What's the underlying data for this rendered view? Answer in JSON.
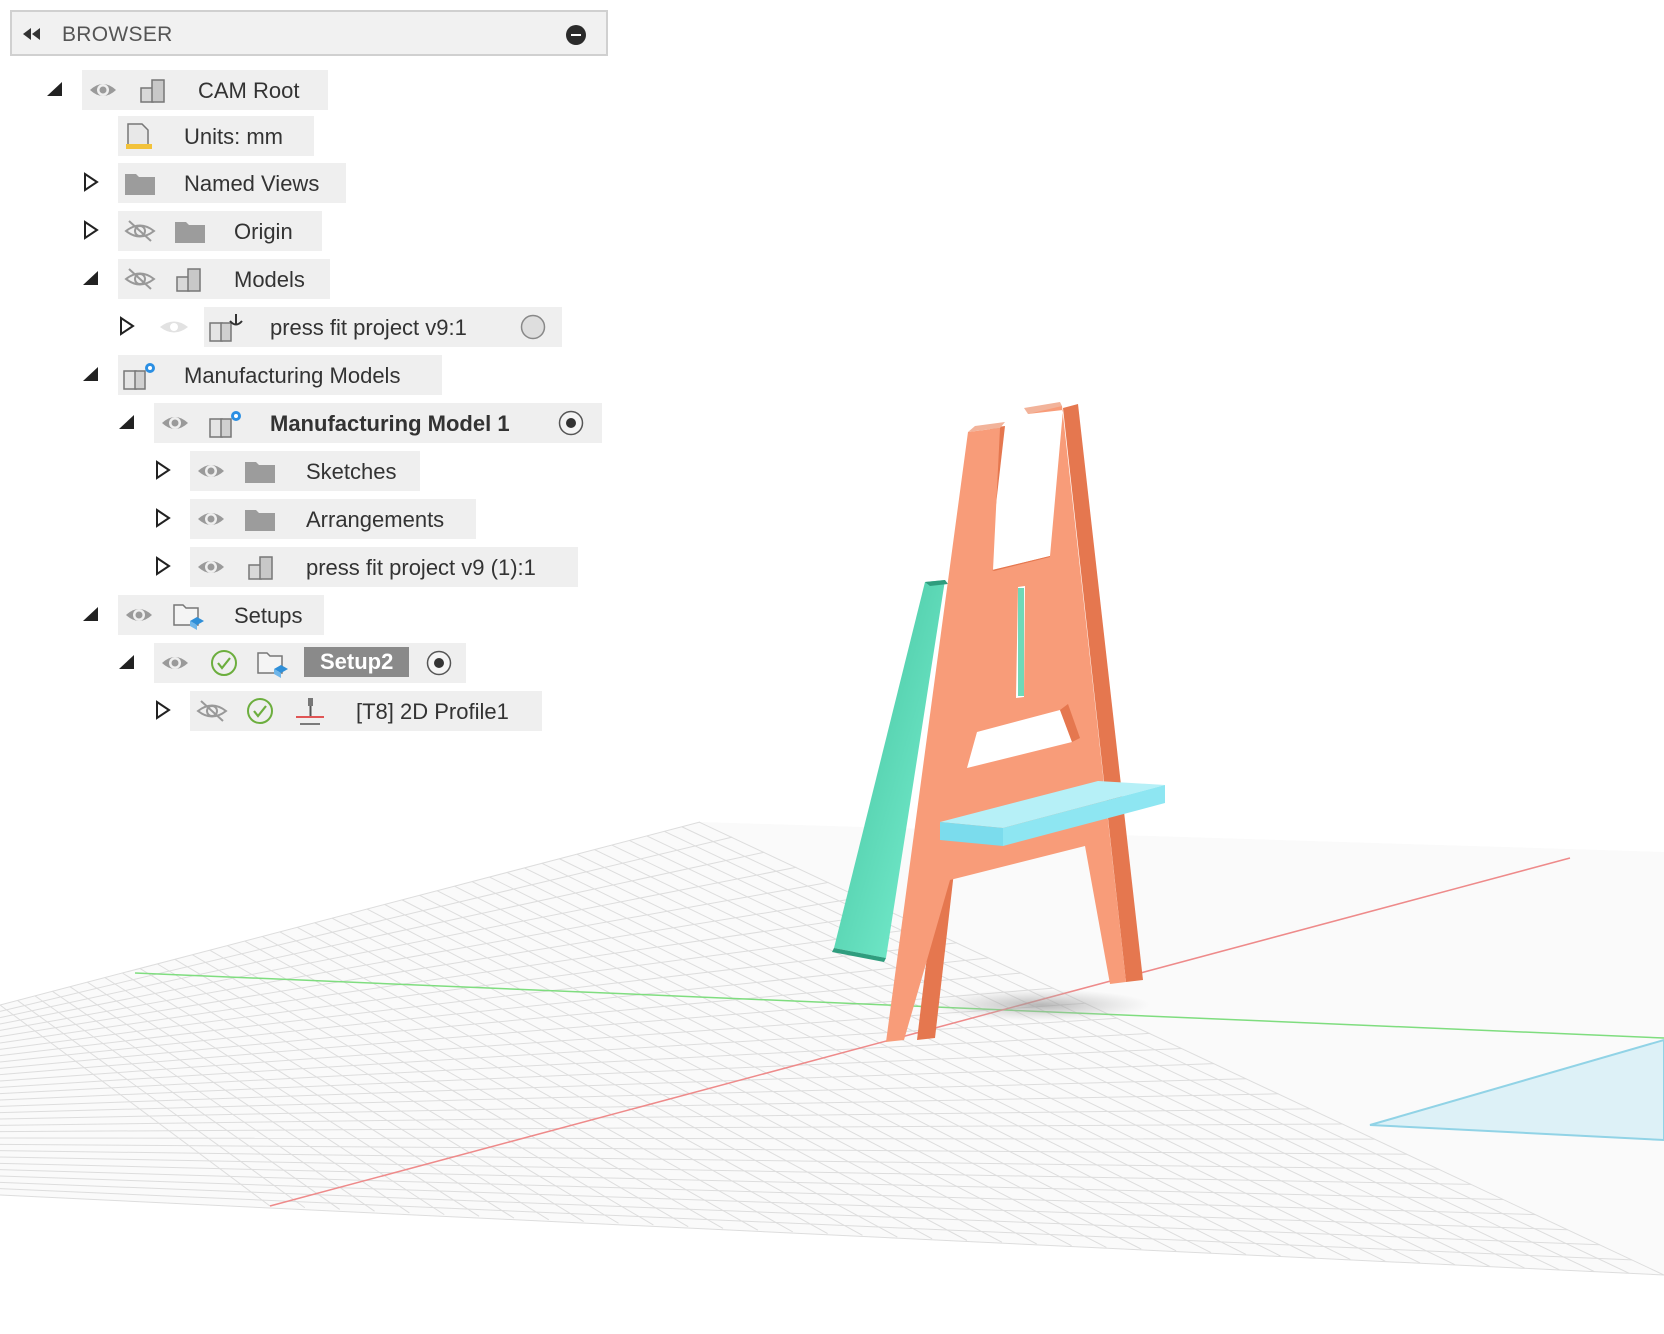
{
  "browser": {
    "title": "BROWSER",
    "icons": {
      "collapse": "double-left-arrow-icon",
      "close": "minus-circle-icon"
    }
  },
  "tree": {
    "cam_root": "CAM Root",
    "units": "Units: mm",
    "named_views": "Named Views",
    "origin": "Origin",
    "models": "Models",
    "press_fit": "press fit project v9:1",
    "manufacturing_models": "Manufacturing Models",
    "manufacturing_model_1": "Manufacturing Model 1",
    "sketches": "Sketches",
    "arrangements": "Arrangements",
    "press_fit_copy": "press fit project v9 (1):1",
    "setups": "Setups",
    "setup2": "Setup2",
    "profile": "[T8] 2D Profile1"
  },
  "colors": {
    "easel_front": "#f79c78",
    "easel_side": "#e87a52",
    "leg_green": "#5fe0bd",
    "shelf_blue": "#8ee6f2",
    "x_axis": "#e86b6b",
    "y_axis": "#6bdc6b",
    "grid": "#dcdcdc",
    "selection": "#8a8a8a",
    "check_green": "#6cae3e"
  }
}
